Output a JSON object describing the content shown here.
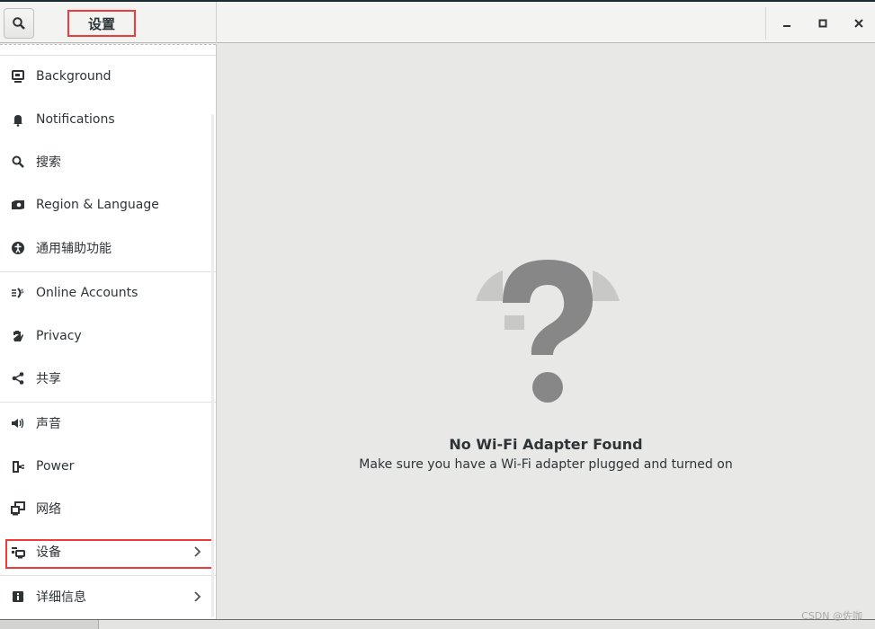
{
  "header": {
    "title": "设置",
    "search_icon": "search-icon"
  },
  "window_controls": {
    "minimize": "minimize-icon",
    "maximize": "maximize-icon",
    "close": "close-icon"
  },
  "sidebar": {
    "items": [
      {
        "label": "Background",
        "icon": "background-icon"
      },
      {
        "label": "Notifications",
        "icon": "bell-icon"
      },
      {
        "label": "搜索",
        "icon": "search-icon"
      },
      {
        "label": "Region & Language",
        "icon": "region-icon"
      },
      {
        "label": "通用辅助功能",
        "icon": "accessibility-icon"
      },
      {
        "label": "Online Accounts",
        "icon": "online-accounts-icon"
      },
      {
        "label": "Privacy",
        "icon": "hand-icon"
      },
      {
        "label": "共享",
        "icon": "share-icon"
      },
      {
        "label": "声音",
        "icon": "speaker-icon"
      },
      {
        "label": "Power",
        "icon": "power-icon"
      },
      {
        "label": "网络",
        "icon": "network-icon"
      },
      {
        "label": "设备",
        "icon": "devices-icon",
        "chevron": true,
        "highlighted": true
      },
      {
        "label": "详细信息",
        "icon": "info-icon",
        "chevron": true
      }
    ]
  },
  "main": {
    "title": "No Wi-Fi Adapter Found",
    "subtitle": "Make sure you have a Wi-Fi adapter plugged and turned on",
    "icon": "question-icon"
  },
  "watermark": "CSDN @佐咖",
  "colors": {
    "highlight_border": "#ef3b3b",
    "icon": "#8a8a8a"
  }
}
